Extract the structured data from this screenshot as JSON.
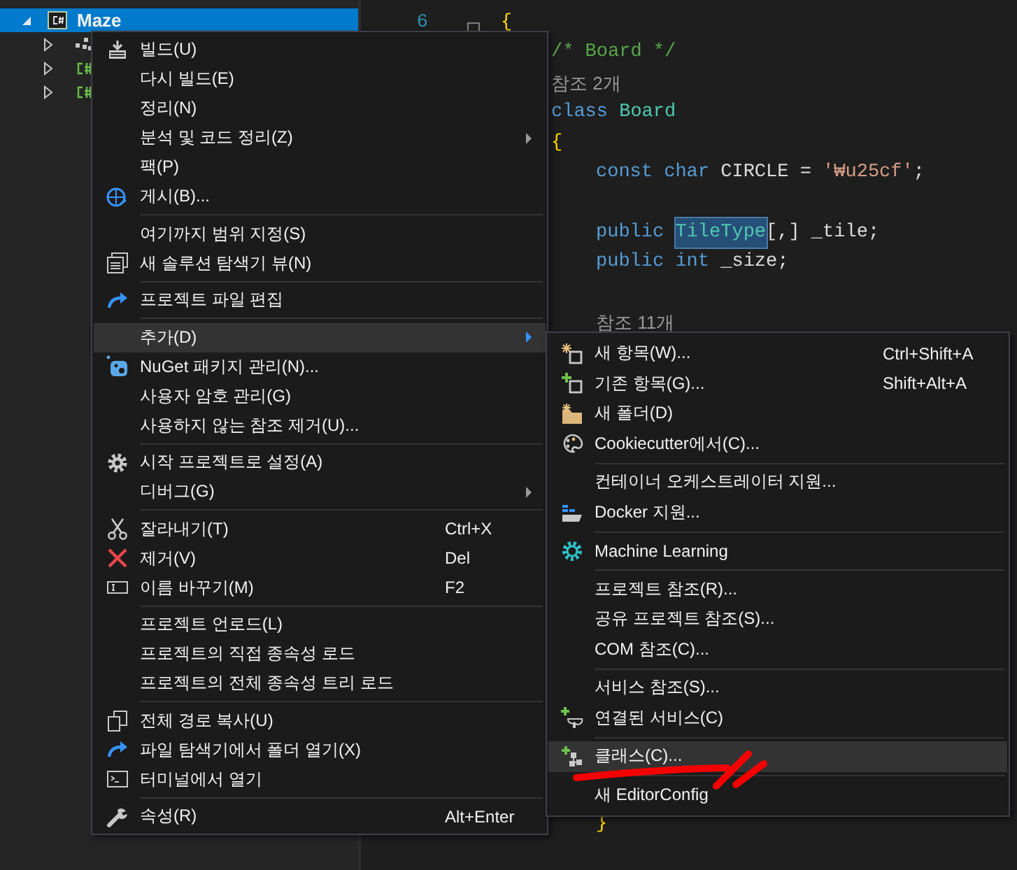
{
  "solution_explorer": {
    "project": {
      "label": "Maze",
      "selected": true,
      "expanded": true
    },
    "children": [
      {
        "expanded": false
      },
      {
        "expanded": false
      },
      {
        "expanded": false
      }
    ]
  },
  "editor": {
    "line_number": "6",
    "lines_top": [
      {
        "kind": "namespace",
        "tokens": [
          {
            "kind": "brace",
            "text": "{"
          }
        ]
      },
      {
        "kind": "class",
        "tokens": [
          {
            "kind": "comment",
            "text": "/* Board */"
          }
        ]
      },
      {
        "kind": "class",
        "tokens": [
          {
            "kind": "codelens",
            "text": "참조 2개"
          }
        ]
      },
      {
        "kind": "class",
        "tokens": [
          {
            "kind": "keyword",
            "text": "class "
          },
          {
            "kind": "type",
            "text": "Board"
          }
        ]
      },
      {
        "kind": "class",
        "tokens": [
          {
            "kind": "brace",
            "text": "{"
          }
        ]
      },
      {
        "kind": "member",
        "tokens": [
          {
            "kind": "keyword",
            "text": "const char "
          },
          {
            "kind": "text",
            "text": "CIRCLE = "
          },
          {
            "kind": "string",
            "text": "'₩u25cf'"
          },
          {
            "kind": "text",
            "text": ";"
          }
        ]
      },
      {
        "kind": "blank"
      },
      {
        "kind": "member",
        "tokens": [
          {
            "kind": "keyword",
            "text": "public "
          },
          {
            "kind": "type",
            "text": "TileType",
            "highlighted": true
          },
          {
            "kind": "text",
            "text": "[,] _tile;"
          }
        ]
      },
      {
        "kind": "member",
        "tokens": [
          {
            "kind": "keyword",
            "text": "public int "
          },
          {
            "kind": "text",
            "text": "_size;"
          }
        ]
      },
      {
        "kind": "blank"
      },
      {
        "kind": "member",
        "tokens": [
          {
            "kind": "codelens",
            "text": "참조 11개"
          }
        ]
      }
    ],
    "lines_bottom": [
      {
        "kind": "member",
        "tokens": [
          {
            "kind": "brace",
            "text": "}"
          }
        ]
      }
    ]
  },
  "context_menu": {
    "items": [
      {
        "kind": "item",
        "label": "빌드(U)",
        "submenu": false,
        "selected": false
      },
      {
        "kind": "item",
        "label": "다시 빌드(E)",
        "submenu": false,
        "selected": false
      },
      {
        "kind": "item",
        "label": "정리(N)",
        "submenu": false,
        "selected": false
      },
      {
        "kind": "item",
        "label": "분석 및 코드 정리(Z)",
        "submenu": true,
        "selected": false
      },
      {
        "kind": "item",
        "label": "팩(P)",
        "submenu": false,
        "selected": false
      },
      {
        "kind": "item",
        "label": "게시(B)...",
        "submenu": false,
        "selected": false
      },
      {
        "kind": "separator"
      },
      {
        "kind": "item",
        "label": "여기까지 범위 지정(S)",
        "submenu": false,
        "selected": false
      },
      {
        "kind": "item",
        "label": "새 솔루션 탐색기 뷰(N)",
        "submenu": false,
        "selected": false
      },
      {
        "kind": "separator"
      },
      {
        "kind": "item",
        "label": "프로젝트 파일 편집",
        "submenu": false,
        "selected": false
      },
      {
        "kind": "separator"
      },
      {
        "kind": "item",
        "label": "추가(D)",
        "submenu": true,
        "selected": true
      },
      {
        "kind": "item",
        "label": "NuGet 패키지 관리(N)...",
        "submenu": false,
        "selected": false
      },
      {
        "kind": "item",
        "label": "사용자 암호 관리(G)",
        "submenu": false,
        "selected": false
      },
      {
        "kind": "item",
        "label": "사용하지 않는 참조 제거(U)...",
        "submenu": false,
        "selected": false
      },
      {
        "kind": "separator"
      },
      {
        "kind": "item",
        "label": "시작 프로젝트로 설정(A)",
        "submenu": false,
        "selected": false
      },
      {
        "kind": "item",
        "label": "디버그(G)",
        "submenu": true,
        "selected": false
      },
      {
        "kind": "separator"
      },
      {
        "kind": "item",
        "label": "잘라내기(T)",
        "shortcut": "Ctrl+X",
        "submenu": false,
        "selected": false
      },
      {
        "kind": "item",
        "label": "제거(V)",
        "shortcut": "Del",
        "submenu": false,
        "selected": false
      },
      {
        "kind": "item",
        "label": "이름 바꾸기(M)",
        "shortcut": "F2",
        "submenu": false,
        "selected": false
      },
      {
        "kind": "separator"
      },
      {
        "kind": "item",
        "label": "프로젝트 언로드(L)",
        "submenu": false,
        "selected": false
      },
      {
        "kind": "item",
        "label": "프로젝트의 직접 종속성 로드",
        "submenu": false,
        "selected": false
      },
      {
        "kind": "item",
        "label": "프로젝트의 전체 종속성 트리 로드",
        "submenu": false,
        "selected": false
      },
      {
        "kind": "separator"
      },
      {
        "kind": "item",
        "label": "전체 경로 복사(U)",
        "submenu": false,
        "selected": false
      },
      {
        "kind": "item",
        "label": "파일 탐색기에서 폴더 열기(X)",
        "submenu": false,
        "selected": false
      },
      {
        "kind": "item",
        "label": "터미널에서 열기",
        "submenu": false,
        "selected": false
      },
      {
        "kind": "separator"
      },
      {
        "kind": "item",
        "label": "속성(R)",
        "shortcut": "Alt+Enter",
        "submenu": false,
        "selected": false
      }
    ]
  },
  "add_submenu": {
    "items": [
      {
        "kind": "item",
        "label": "새 항목(W)...",
        "shortcut": "Ctrl+Shift+A",
        "submenu": false,
        "selected": false
      },
      {
        "kind": "item",
        "label": "기존 항목(G)...",
        "shortcut": "Shift+Alt+A",
        "submenu": false,
        "selected": false
      },
      {
        "kind": "item",
        "label": "새 폴더(D)",
        "submenu": false,
        "selected": false
      },
      {
        "kind": "item",
        "label": "Cookiecutter에서(C)...",
        "submenu": false,
        "selected": false
      },
      {
        "kind": "separator"
      },
      {
        "kind": "item",
        "label": "컨테이너 오케스트레이터 지원...",
        "submenu": false,
        "selected": false
      },
      {
        "kind": "item",
        "label": "Docker 지원...",
        "submenu": false,
        "selected": false
      },
      {
        "kind": "separator"
      },
      {
        "kind": "item",
        "label": "Machine Learning",
        "submenu": false,
        "selected": false
      },
      {
        "kind": "separator"
      },
      {
        "kind": "item",
        "label": "프로젝트 참조(R)...",
        "submenu": false,
        "selected": false
      },
      {
        "kind": "item",
        "label": "공유 프로젝트 참조(S)...",
        "submenu": false,
        "selected": false
      },
      {
        "kind": "item",
        "label": "COM 참조(C)...",
        "submenu": false,
        "selected": false
      },
      {
        "kind": "separator"
      },
      {
        "kind": "item",
        "label": "서비스 참조(S)...",
        "submenu": false,
        "selected": false
      },
      {
        "kind": "item",
        "label": "연결된 서비스(C)",
        "submenu": false,
        "selected": false
      },
      {
        "kind": "separator"
      },
      {
        "kind": "item",
        "label": "클래스(C)...",
        "submenu": false,
        "selected": true
      },
      {
        "kind": "separator"
      },
      {
        "kind": "item",
        "label": "새 EditorConfig",
        "submenu": false,
        "selected": false
      }
    ]
  }
}
